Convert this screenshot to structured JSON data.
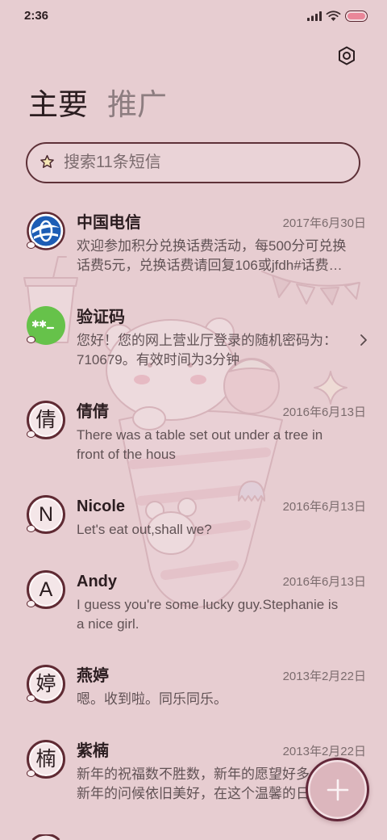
{
  "status_bar": {
    "time": "2:36",
    "icons": [
      "signal-icon",
      "wifi-icon",
      "battery-icon"
    ],
    "battery_level": 1
  },
  "toolbar": {
    "settings_icon": "settings-icon"
  },
  "tabs": [
    {
      "label": "主要",
      "selected": true
    },
    {
      "label": "推广",
      "selected": false
    }
  ],
  "search": {
    "placeholder": "搜索11条短信",
    "icon": "star-icon"
  },
  "conversations": [
    {
      "name": "中国电信",
      "date": "2017年6月30日",
      "preview": [
        "欢迎参加积分兑换话费活动，每500分可兑换",
        "话费5元，兑换话费请回复106或jfdh#话费…"
      ],
      "avatar": {
        "type": "logo",
        "icon": "china-telecom-logo-icon"
      }
    },
    {
      "name": "验证码",
      "preview": [
        "您好！您的网上营业厅登录的随机密码为：",
        "710679。有效时间为3分钟"
      ],
      "avatar": {
        "type": "icon",
        "icon": "verification-code-icon"
      },
      "trailing_icon": "chevron-right-icon"
    },
    {
      "name": "倩倩",
      "date": "2016年6月13日",
      "preview": [
        "There was a table set out under a tree in",
        "front of the hous"
      ],
      "avatar": {
        "type": "letter",
        "letter": "倩"
      }
    },
    {
      "name": "Nicole",
      "date": "2016年6月13日",
      "preview": [
        "Let's eat out,shall we?"
      ],
      "avatar": {
        "type": "letter",
        "letter": "N"
      }
    },
    {
      "name": "Andy",
      "date": "2016年6月13日",
      "preview": [
        "I guess you're some lucky guy.Stephanie is",
        "a nice girl."
      ],
      "avatar": {
        "type": "letter",
        "letter": "A"
      }
    },
    {
      "name": "燕婷",
      "date": "2013年2月22日",
      "preview": [
        "嗯。收到啦。同乐同乐。"
      ],
      "avatar": {
        "type": "letter",
        "letter": "婷"
      }
    },
    {
      "name": "紫楠",
      "date": "2013年2月22日",
      "preview": [
        "新年的祝福数不胜数，新年的愿望好多",
        "新年的问候依旧美好，在这个温馨的日"
      ],
      "avatar": {
        "type": "letter",
        "letter": "楠"
      }
    }
  ],
  "fab": {
    "icon": "plus-icon"
  },
  "colors": {
    "background": "#e7cdd1",
    "accent_border": "#5f2a33",
    "text": "#2b1d20",
    "muted_text": "#7c6c6e",
    "verification_avatar": "#66c24a",
    "telecom_blue": "#1d5db5"
  }
}
